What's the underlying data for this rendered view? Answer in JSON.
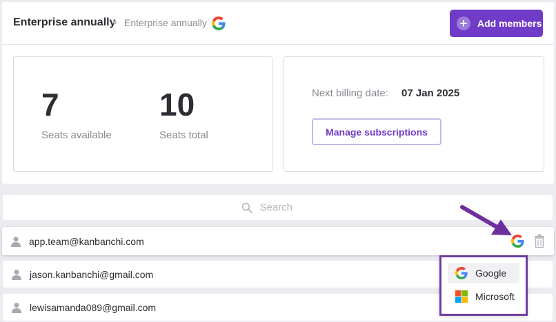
{
  "header": {
    "plan_title": "Enterprise annually",
    "plan_subtitle": "Enterprise annually",
    "add_members_label": "Add members"
  },
  "seats": {
    "available_value": "7",
    "available_label": "Seats available",
    "total_value": "10",
    "total_label": "Seats total"
  },
  "billing": {
    "next_label": "Next billing date:",
    "next_date": "07 Jan 2025",
    "manage_label": "Manage subscriptions"
  },
  "search": {
    "placeholder": "Search"
  },
  "members": [
    {
      "email": "app.team@kanbanchi.com"
    },
    {
      "email": "jason.kanbanchi@gmail.com"
    },
    {
      "email": "lewisamanda089@gmail.com"
    }
  ],
  "provider_menu": {
    "items": [
      {
        "label": "Google",
        "icon": "google-icon"
      },
      {
        "label": "Microsoft",
        "icon": "microsoft-icon"
      }
    ]
  },
  "colors": {
    "accent": "#6f3bc7",
    "highlight_border": "#6d3ba0",
    "background": "#ebebf0"
  }
}
